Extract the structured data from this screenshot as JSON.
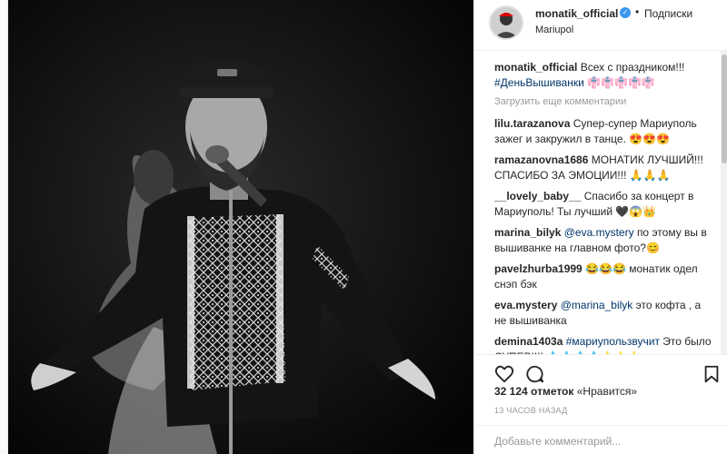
{
  "header": {
    "username": "monatik_official",
    "verified_icon": "verified-badge-icon",
    "separator": "•",
    "follow_label": "Подписки",
    "location": "Mariupol"
  },
  "caption": {
    "user": "monatik_official",
    "text": "Всех с праздником!!!",
    "hashtag": "#ДеньВышиванки",
    "emoji": "👘👘👘👘👘"
  },
  "load_more": "Загрузить еще комментарии",
  "comments": [
    {
      "user": "lilu.tarazanova",
      "text": "Супер-супер Мариуполь зажег и закружил в танце. 😍😍😍"
    },
    {
      "user": "ramazanovna1686",
      "text": "МОНАТИК ЛУЧШИЙ!!! СПАСИБО ЗА ЭМОЦИИ!!! 🙏🙏🙏"
    },
    {
      "user": "__lovely_baby__",
      "text": "Спасибо за концерт в Мариуполь! Ты лучший 🖤😱👑"
    },
    {
      "user": "marina_bilyk",
      "mention": "@eva.mystery",
      "text": "по этому вы в вышиванке на главном фото?😊"
    },
    {
      "user": "pavelzhurba1999",
      "text": "😂😂😂 монатик одел снэп бэк"
    },
    {
      "user": "eva.mystery",
      "mention": "@marina_bilyk",
      "text": "это кофта , а не вышиванка"
    },
    {
      "user": "demina1403a",
      "mention": "#мариупользвучит",
      "text": "Это было СУПЕР!!!! 💧💧💧💧⭐⭐⭐"
    }
  ],
  "actions": {
    "like_icon": "heart-icon",
    "comment_icon": "comment-icon",
    "save_icon": "bookmark-icon"
  },
  "likes": {
    "count": "32 124 отметок",
    "label": "«Нравится»"
  },
  "timestamp": "13 ЧАСОВ НАЗАД",
  "add_comment_placeholder": "Добавьте комментарий..."
}
